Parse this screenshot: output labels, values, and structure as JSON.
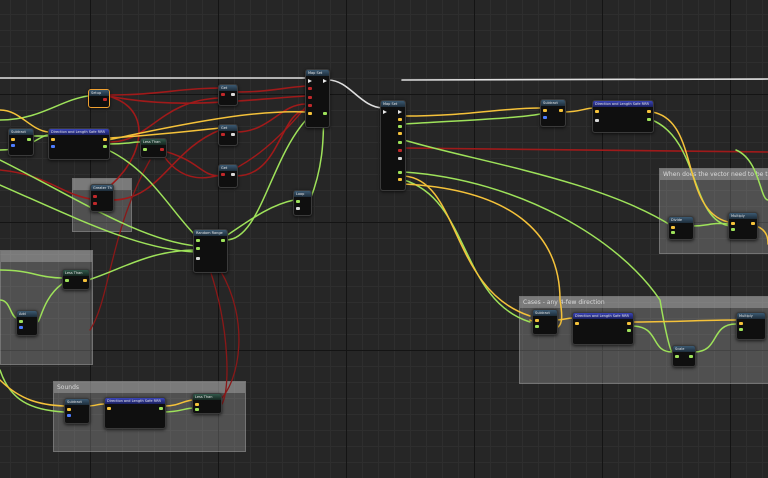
{
  "comments": {
    "c1": {
      "title": ""
    },
    "c2": {
      "title": ""
    },
    "c3": {
      "title": "Sounds"
    },
    "c4": {
      "title": "When does the vector need to be taken to the point we've... (probably) ..."
    },
    "c5": {
      "title": "Cases - any 4-few direction"
    }
  },
  "nodes": {
    "setup": "Setup",
    "make_array": "Map Set",
    "map_set": "Map Set",
    "subtract_a": "Subtract",
    "dir_len_a": "Direction and Length Safe RRR",
    "less_a": "Less Than",
    "get_a": "Get",
    "get_b": "Get",
    "get_c": "Get",
    "random": "Random Range",
    "loop": "Loop",
    "less_b": "Less Than",
    "add_a": "Add",
    "subtract_b": "Subtract",
    "dir_len_b": "Direction and Length Safe RRR",
    "less_c": "Less Than",
    "subtract_c": "Subtract",
    "dir_len_c": "Direction and Length Safe RRR",
    "divide": "Divide",
    "multiply_a": "Multiply",
    "subtract_d": "Subtract",
    "dir_len_d": "Direction and Length Safe RRR",
    "scale": "Scale",
    "multiply_b": "Multiply",
    "misc_small": "Greater Th"
  },
  "wire_colors": {
    "exec": "#e8e8e8",
    "float": "#9ee25a",
    "vector": "#f5c23a",
    "object": "#b01c1c"
  }
}
